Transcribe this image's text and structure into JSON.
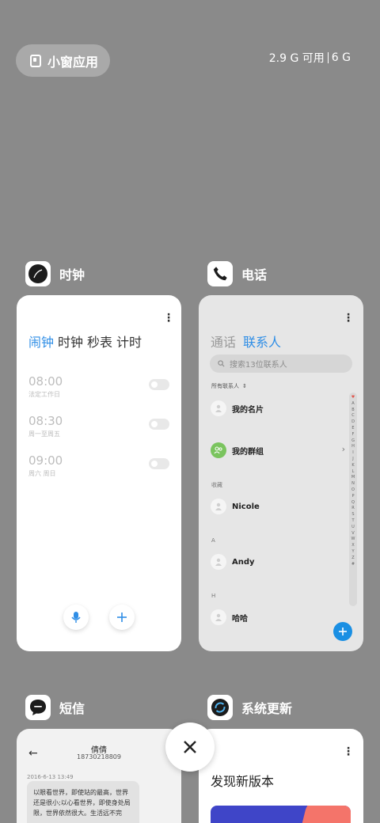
{
  "top": {
    "small_window_label": "小窗应用",
    "memory_available": "2.9 G 可用",
    "memory_total": "6 G"
  },
  "apps": {
    "clock": {
      "name": "时钟",
      "tabs": [
        "闹钟",
        "时钟",
        "秒表",
        "计时"
      ],
      "alarms": [
        {
          "time": "08:00",
          "repeat": "法定工作日"
        },
        {
          "time": "08:30",
          "repeat": "周一至周五"
        },
        {
          "time": "09:00",
          "repeat": "周六 周日"
        }
      ]
    },
    "phone": {
      "name": "电话",
      "tabs": [
        "通话",
        "联系人"
      ],
      "search_placeholder": "搜索13位联系人",
      "all_contacts": "所有联系人",
      "my_card": "我的名片",
      "my_groups": "我的群组",
      "section_favorites": "收藏",
      "contact_nicole": "Nicole",
      "section_a": "A",
      "contact_andy": "Andy",
      "section_h": "H",
      "contact_haha": "哈哈",
      "alphabet": [
        "♥",
        "A",
        "B",
        "C",
        "D",
        "E",
        "F",
        "G",
        "H",
        "I",
        "J",
        "K",
        "L",
        "M",
        "N",
        "O",
        "P",
        "Q",
        "R",
        "S",
        "T",
        "U",
        "V",
        "W",
        "X",
        "Y",
        "Z",
        "#"
      ]
    },
    "messages": {
      "name": "短信",
      "contact_name": "倩倩",
      "contact_number": "18730218809",
      "date": "2016-6-13 13:49",
      "bubble_text": "以眼看世界，即使站的最高，世界还是很小;以心看世界，即使身处局限，世界依然很大。生活远不完"
    },
    "update": {
      "name": "系统更新",
      "title": "发现新版本"
    }
  },
  "colors": {
    "background": "#8a8a8a",
    "accent_blue": "#2f8ee6",
    "fab_blue": "#1a8fe3",
    "group_green": "#7ac45e",
    "banner_blue": "#3f45c8",
    "banner_coral": "#f4746a"
  },
  "icons": {
    "clock_app": "clock-face-icon",
    "phone_app": "phone-handset-icon",
    "messages_app": "chat-bubble-icon",
    "update_app": "refresh-arrow-icon",
    "close": "close-x-icon"
  }
}
